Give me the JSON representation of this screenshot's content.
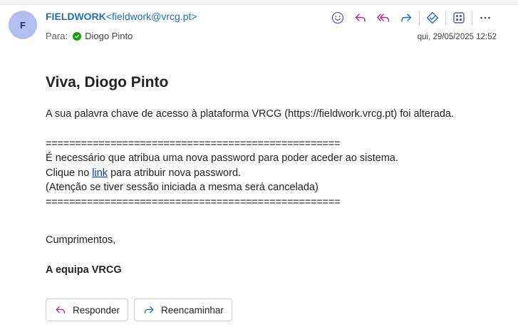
{
  "sender": {
    "avatar_initial": "F",
    "name": "FIELDWORK",
    "email": "<fieldwork@vrcg.pt>"
  },
  "recipient": {
    "label": "Para:",
    "name": "Diogo Pinto"
  },
  "date": "qui, 29/05/2025 12:52",
  "toolbar": {
    "icons": [
      "smiley-icon",
      "reply-icon",
      "reply-all-icon",
      "forward-icon",
      "viva-insights-icon",
      "apps-icon",
      "more-icon"
    ]
  },
  "message": {
    "greeting": "Viva, Diogo Pinto",
    "line1": "A sua palavra chave de acesso à plataforma VRCG (https://fieldwork.vrcg.pt) foi alterada.",
    "separator": "==================================================",
    "line2": "É necessário que atribua uma nova password para poder aceder ao sistema.",
    "line3_pre": "Clique no ",
    "line3_link": "link",
    "line3_post": " para atribuir nova password.",
    "line4": "(Atenção se tiver sessão iniciada a mesma será cancelada)",
    "closing": "Cumprimentos,",
    "signature": "A equipa VRCG"
  },
  "actions": {
    "reply_label": "Responder",
    "forward_label": "Reencaminhar"
  },
  "colors": {
    "sender": "#1f6fc1",
    "accent": "#5b5fc7",
    "reply_icon": "#b5278f",
    "link": "#0b33c9",
    "presence": "#13a10e",
    "avatar_bg": "#b4bdf0"
  }
}
